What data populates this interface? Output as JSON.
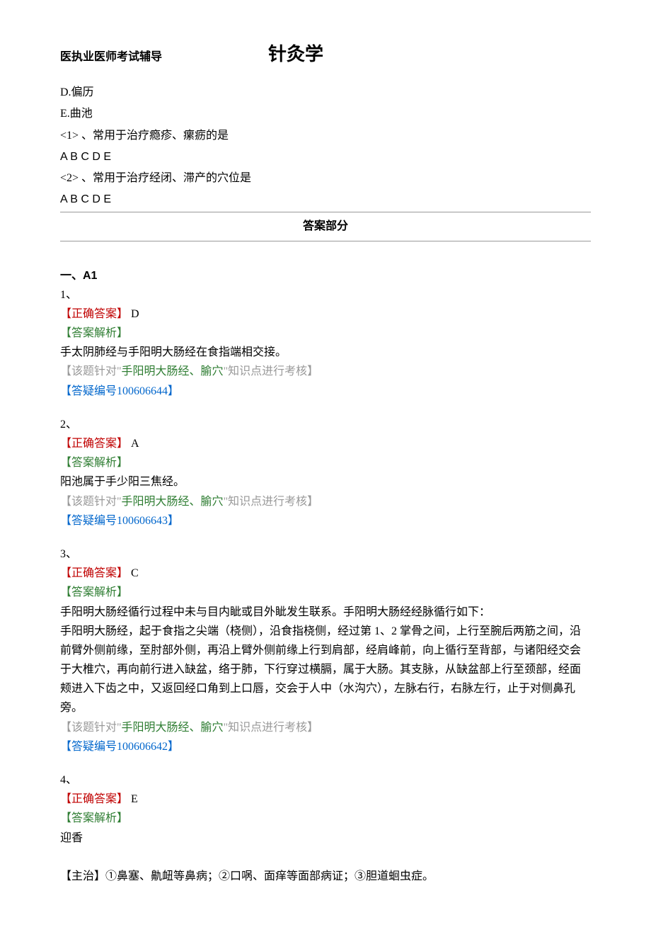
{
  "header": {
    "left": "医执业医师考试辅导",
    "center": "针灸学"
  },
  "intro": {
    "optionD": "D.偏历",
    "optionE": "E.曲池",
    "q1": "<1> 、常用于治疗瘾疹、瘰疬的是",
    "q1opts": "A B C D E",
    "q2": "<2> 、常用于治疗经闭、滞产的穴位是",
    "q2opts": "A B C D E"
  },
  "answerHeader": "答案部分",
  "sectionHead": "一、A1",
  "answers": [
    {
      "num": "1、",
      "correctLabel": "【正确答案】",
      "correctValue": " D",
      "analysisLabel": "【答案解析】",
      "analysisBody": [
        "手太阴肺经与手阳明大肠经在食指端相交接。"
      ],
      "topicPrefix": "【该题针对\"",
      "topicLink": "手阳明大肠经、腧穴",
      "topicSuffix": "\"知识点进行考核】",
      "qidLabel": "【答疑编号",
      "qidNum": "100606644",
      "qidClose": "】"
    },
    {
      "num": "2、",
      "correctLabel": "【正确答案】",
      "correctValue": " A",
      "analysisLabel": "【答案解析】",
      "analysisBody": [
        "阳池属于手少阳三焦经。"
      ],
      "topicPrefix": "【该题针对\"",
      "topicLink": "手阳明大肠经、腧穴",
      "topicSuffix": "\"知识点进行考核】",
      "qidLabel": "【答疑编号",
      "qidNum": "100606643",
      "qidClose": "】"
    },
    {
      "num": "3、",
      "correctLabel": "【正确答案】",
      "correctValue": " C",
      "analysisLabel": "【答案解析】",
      "analysisBody": [
        "手阳明大肠经循行过程中未与目内眦或目外眦发生联系。手阳明大肠经经脉循行如下：",
        "手阳明大肠经，起于食指之尖端（桡侧），沿食指桡侧，经过第 1、2 掌骨之间，上行至腕后两筋之间，沿前臂外侧前缘，至肘部外侧，再沿上臂外侧前缘上行到肩部，经肩峰前，向上循行至背部，与诸阳经交会于大椎穴，再向前行进入缺盆，络于肺，下行穿过横膈，属于大肠。其支脉，从缺盆部上行至颈部，经面颊进入下齿之中，又返回经口角到上口唇，交会于人中（水沟穴），左脉右行，右脉左行，止于对侧鼻孔旁。"
      ],
      "topicPrefix": "【该题针对\"",
      "topicLink": "手阳明大肠经、腧穴",
      "topicSuffix": "\"知识点进行考核】",
      "qidLabel": "【答疑编号",
      "qidNum": "100606642",
      "qidClose": "】"
    },
    {
      "num": "4、",
      "correctLabel": "【正确答案】",
      "correctValue": " E",
      "analysisLabel": "【答案解析】",
      "analysisBody": [
        "迎香",
        "",
        "【主治】①鼻塞、鼽衄等鼻病；②口㖞、面痒等面部病证；③胆道蛔虫症。"
      ],
      "topicPrefix": "",
      "topicLink": "",
      "topicSuffix": "",
      "qidLabel": "",
      "qidNum": "",
      "qidClose": ""
    }
  ]
}
